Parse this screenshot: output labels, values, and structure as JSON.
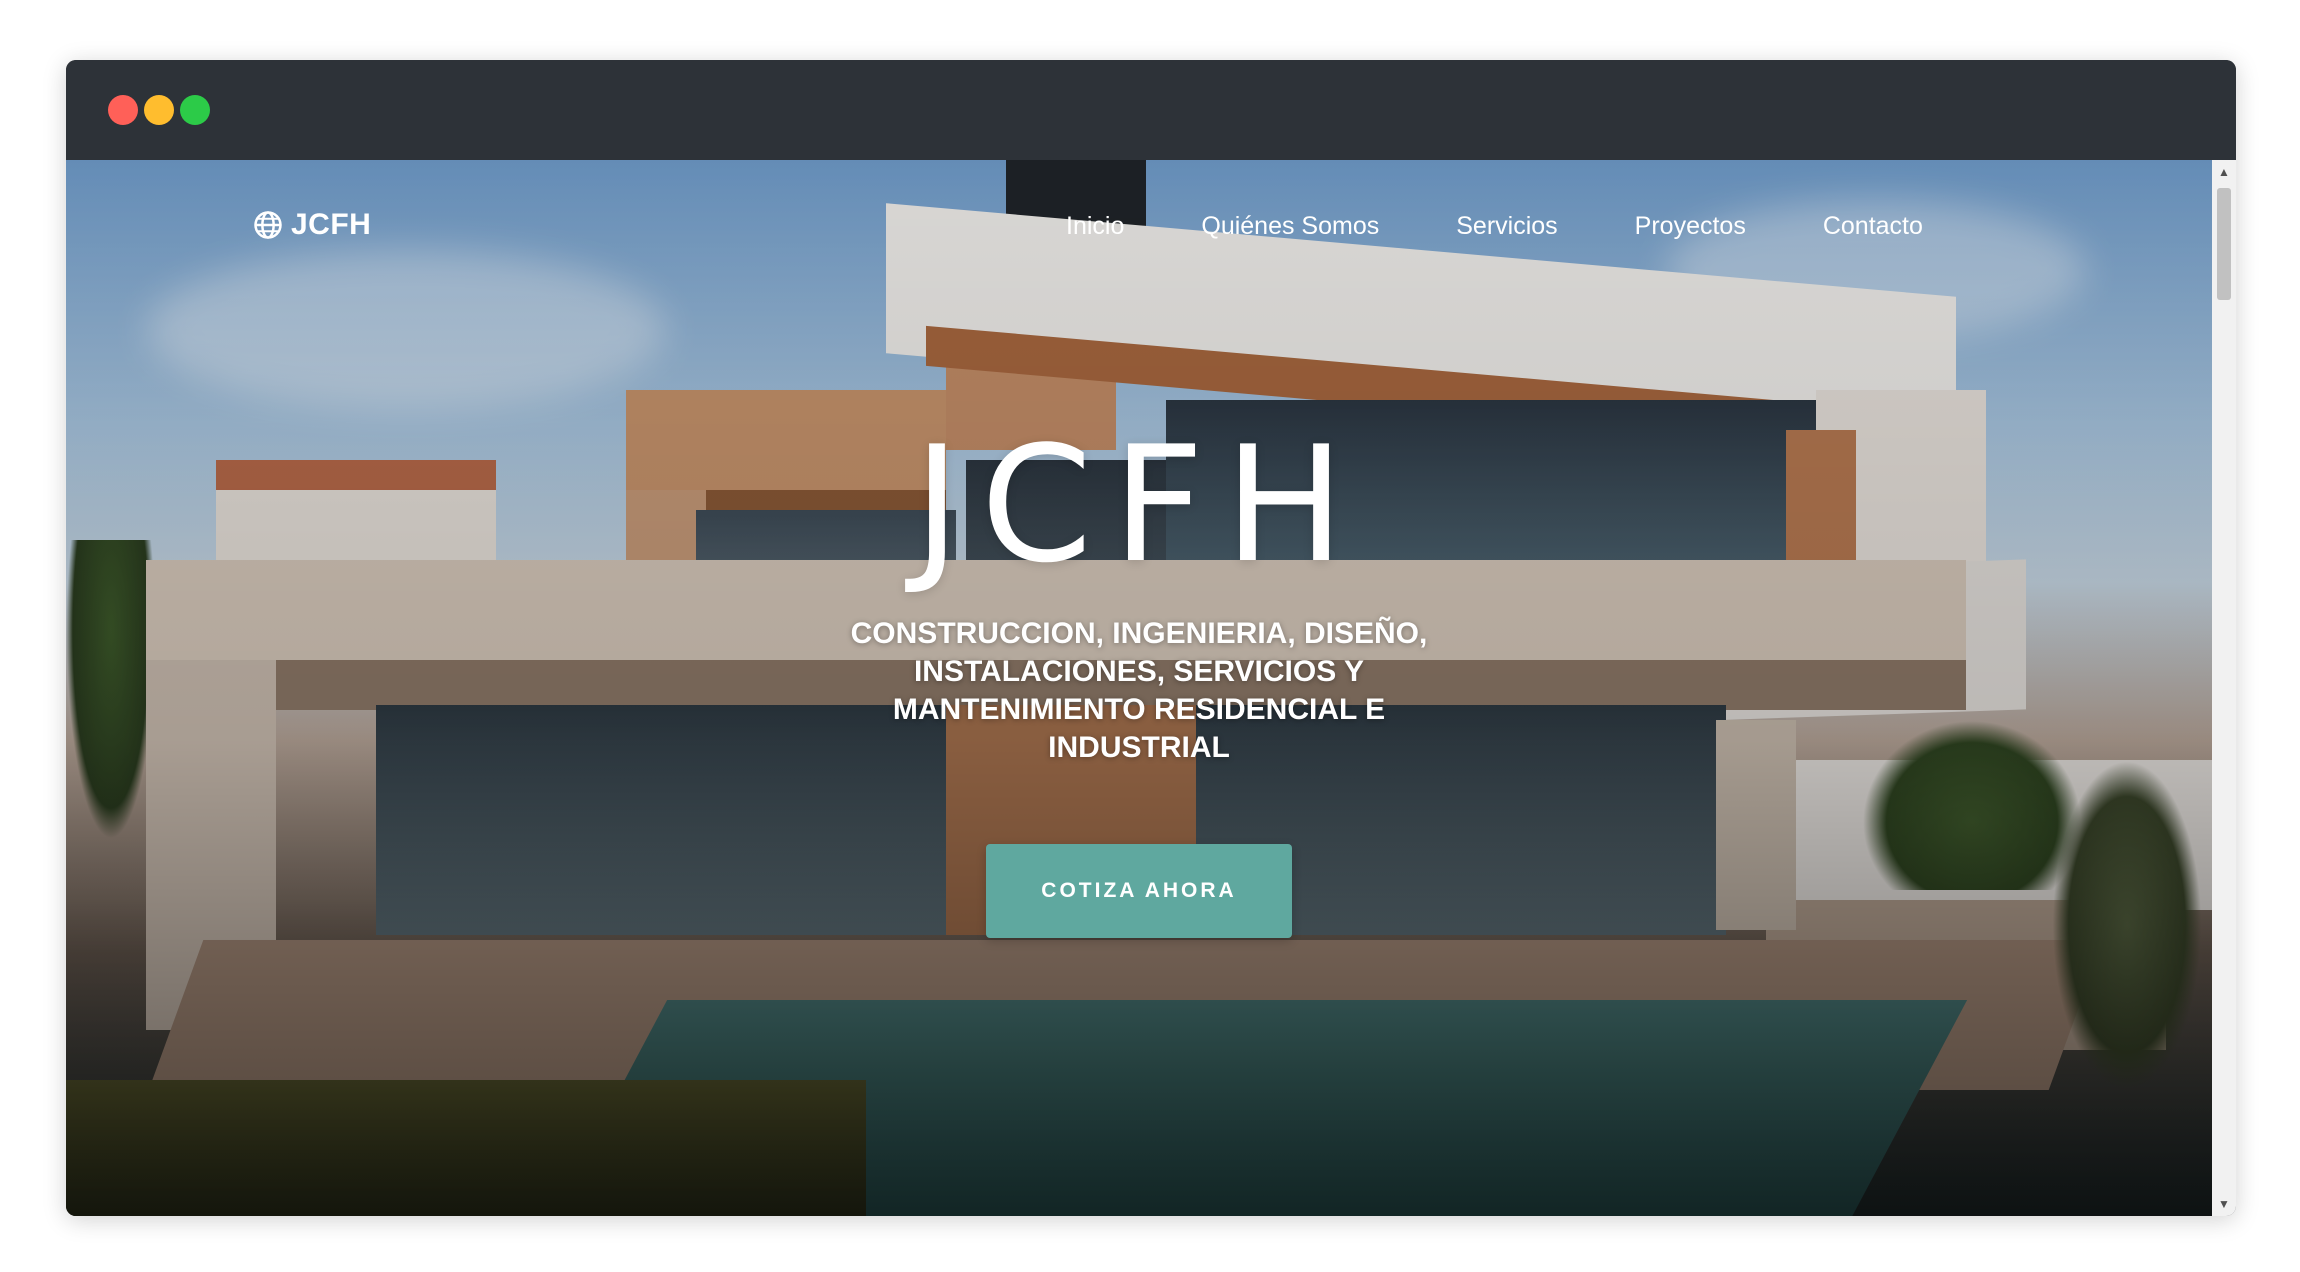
{
  "window": {
    "controls": [
      "close",
      "minimize",
      "maximize"
    ],
    "colors": {
      "close": "#ff6058",
      "minimize": "#ffbd2e",
      "maximize": "#2ccb48",
      "titlebar": "#2d3238"
    }
  },
  "header": {
    "logo_icon": "globe-icon",
    "logo_text": "JCFH",
    "nav": [
      {
        "label": "Inicio"
      },
      {
        "label": "Quiénes Somos"
      },
      {
        "label": "Servicios"
      },
      {
        "label": "Proyectos"
      },
      {
        "label": "Contacto"
      }
    ]
  },
  "hero": {
    "title": "JCFH",
    "subtitle": "CONSTRUCCION, INGENIERIA, DISEÑO, INSTALACIONES, SERVICIOS Y MANTENIMIENTO RESIDENCIAL E INDUSTRIAL",
    "cta_label": "COTIZA AHORA",
    "cta_color": "#5fa89f"
  },
  "scrollbar": {
    "up_icon": "caret-up-icon",
    "down_icon": "caret-down-icon"
  }
}
